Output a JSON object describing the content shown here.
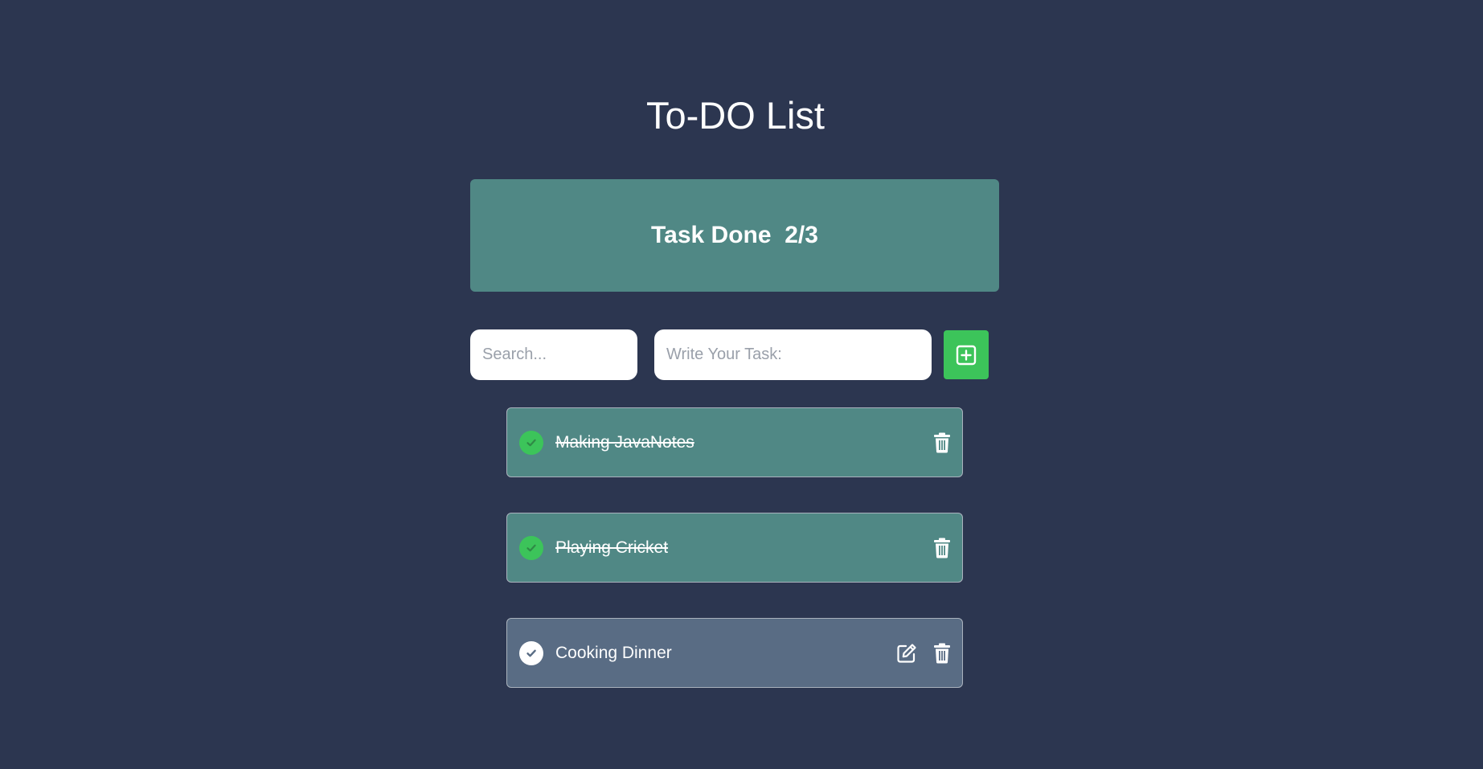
{
  "app": {
    "title": "To-DO List"
  },
  "summary": {
    "label": "Task Done",
    "count": "2/3"
  },
  "search": {
    "placeholder": "Search...",
    "value": ""
  },
  "new_task": {
    "placeholder": "Write Your Task:",
    "value": ""
  },
  "add_button": {
    "icon": "plus-square-icon"
  },
  "tasks": [
    {
      "label": "Making JavaNotes",
      "done": true
    },
    {
      "label": "Playing Cricket",
      "done": true
    },
    {
      "label": "Cooking Dinner",
      "done": false
    }
  ],
  "colors": {
    "background": "#2c3650",
    "card": "#508885",
    "pending_item": "#596c84",
    "accent_green": "#3cc45a"
  }
}
